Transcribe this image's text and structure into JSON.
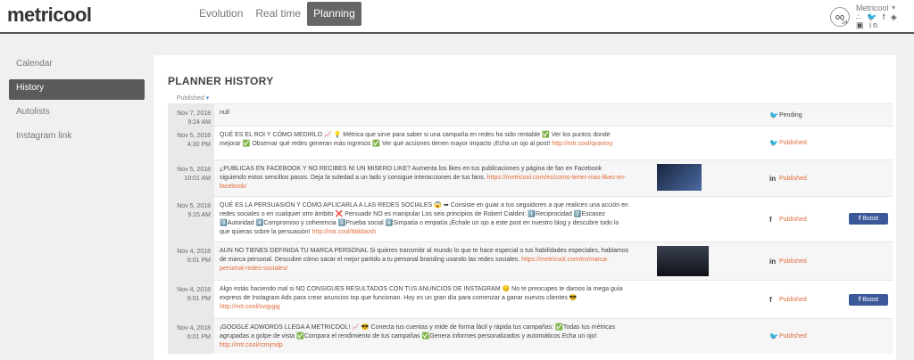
{
  "app": {
    "logo": "metricool"
  },
  "nav": [
    {
      "label": "Evolution",
      "active": false
    },
    {
      "label": "Real time",
      "active": false
    },
    {
      "label": "Planning",
      "active": true
    }
  ],
  "account": {
    "name": "Metricool",
    "avatar_glyph": "oo",
    "social_icons": "rss twitter facebook foursquare instagram linkedin",
    "social_glyphs": "∴ 🐦 f ◈ ▣ in"
  },
  "sidebar": [
    {
      "label": "Calendar",
      "active": false
    },
    {
      "label": "History",
      "active": true
    },
    {
      "label": "Autolists",
      "active": false
    },
    {
      "label": "Instagram link",
      "active": false
    }
  ],
  "main": {
    "title": "PLANNER HISTORY",
    "column_header": "Published",
    "boost_label": "Boost",
    "rows": [
      {
        "date": "Nov 7, 2018",
        "time": "9:24 AM",
        "text": "null",
        "link": "",
        "network": "twitter",
        "status": "Pending",
        "thumb": "",
        "boost": false
      },
      {
        "date": "Nov 5, 2018",
        "time": "4:30 PM",
        "text": "QUÉ ES EL ROI Y CÓMO MEDIRLO 📈 💡 Métrica que sirve para saber si una campaña en redes ha sido rentable ✅ Ver los puntos donde mejorar ✅ Observar qué redes generan más ingresos ✅ Ver qué acciones tienen mayor impacto ¡Echa un ojo al post!",
        "link": "http://mtr.cool/qvarexy",
        "network": "twitter",
        "status": "Published",
        "thumb": "",
        "boost": false
      },
      {
        "date": "Nov 5, 2018",
        "time": "10:01 AM",
        "text": "¿PUBLICAS EN FACEBOOK Y NO RECIBES NI UN MISERO LIKE? Aumenta los likes en tus publicaciones y página de fan en Facebook siguiendo estos sencillos pasos. Deja la soledad a un lado y consigue interacciones de tus fans.",
        "link": "https://metricool.com/es/como-tener-mas-likes-en-facebook/",
        "network": "linkedin",
        "status": "Published",
        "thumb": "blue",
        "boost": false
      },
      {
        "date": "Nov 5, 2018",
        "time": "9:15 AM",
        "text": "QUÉ ES LA PERSUASIÓN Y CÓMO APLICARLA A LAS REDES SOCIALES 😱 ➡ Consiste en guiar a tus seguidores a que realicen una acción en redes sociales o en cualquier otro ámbito ❌ Persuadir NO es manipular Los seis principios de Robert Cialdini: 1️⃣Reciprocidad 2️⃣Escasez 3️⃣Autoridad 4️⃣Compromiso y coherencia 5️⃣Prueba social 6️⃣Simpatía o empatía ¡Échale un ojo a este post en nuestro blog y descubre todo lo que quieras sobre la persuasión!",
        "link": "http://mtr.cool/bbkbwxh",
        "network": "facebook",
        "status": "Published",
        "thumb": "",
        "boost": true
      },
      {
        "date": "Nov 4, 2018",
        "time": "6:01 PM",
        "text": "AUN NO TIENES DEFINIDA TU MARCA PERSONAL Si quieres transmitir al mundo lo que te hace especial o tus habilidades especiales, hablamos de marca personal. Descubre cómo sacar el mejor partido a tu personal branding usando las redes sociales.",
        "link": "https://metricool.com/es/marca-personal-redes-sociales/",
        "network": "linkedin",
        "status": "Published",
        "thumb": "dark",
        "boost": false
      },
      {
        "date": "Nov 4, 2018",
        "time": "6:01 PM",
        "text": "Algo estás haciendo mal si NO CONSIGUES RESULTADOS CON TUS ANUNCIOS DE INSTAGRAM 😔 No te preocupes te damos la mega guía express de Instagram Ads para crear anuncios top que funcionan. Hoy es un gran día para comenzar a ganar nuevos clientes 😎",
        "link": "http://mtr.cool/svqygig",
        "network": "facebook",
        "status": "Published",
        "thumb": "",
        "boost": true
      },
      {
        "date": "Nov 4, 2018",
        "time": "6:01 PM",
        "text": "¡GOOGLE ADWORDS LLEGA A METRICOOL! 📈 😎 Conecta tus cuentas y mide de forma fácil y rápida tus campañas: ✅Todas tus métricas agrupadas a golpe de vista ✅Compara el rendimiento de tus campañas ✅Genera informes personalizados y automáticos Echa un ojo!",
        "link": "http://mtr.cool/rcmjmdp",
        "network": "twitter",
        "status": "Published",
        "thumb": "",
        "boost": false
      }
    ]
  },
  "colors": {
    "accent_orange": "#e06b3a",
    "facebook_blue": "#3b5998",
    "dark_nav": "#666666"
  }
}
